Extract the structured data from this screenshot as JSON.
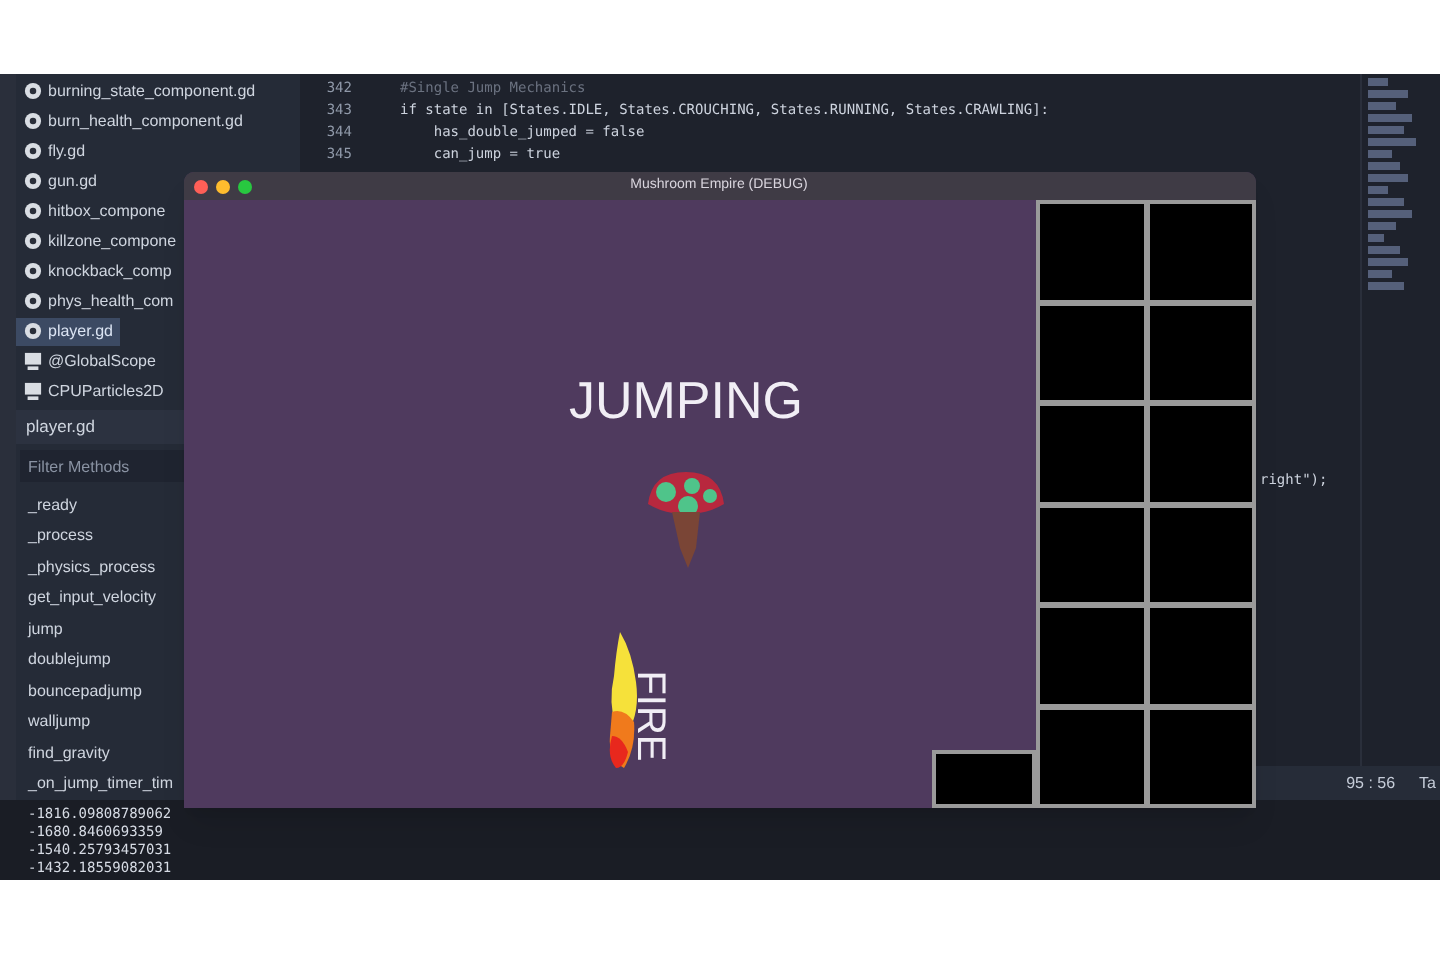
{
  "script_list": {
    "items": [
      {
        "label": "burning_state_component.gd",
        "kind": "script",
        "selected": false
      },
      {
        "label": "burn_health_component.gd",
        "kind": "script",
        "selected": false
      },
      {
        "label": "fly.gd",
        "kind": "script",
        "selected": false
      },
      {
        "label": "gun.gd",
        "kind": "script",
        "selected": false
      },
      {
        "label": "hitbox_compone",
        "kind": "script",
        "selected": false
      },
      {
        "label": "killzone_compone",
        "kind": "script",
        "selected": false
      },
      {
        "label": "knockback_comp",
        "kind": "script",
        "selected": false
      },
      {
        "label": "phys_health_com",
        "kind": "script",
        "selected": false
      },
      {
        "label": "player.gd",
        "kind": "script",
        "selected": true
      },
      {
        "label": "@GlobalScope",
        "kind": "class",
        "selected": false
      },
      {
        "label": "CPUParticles2D",
        "kind": "class",
        "selected": false
      }
    ]
  },
  "current_script": "player.gd",
  "method_filter": {
    "placeholder": "Filter Methods"
  },
  "methods": [
    "_ready",
    "_process",
    "_physics_process",
    "get_input_velocity",
    "jump",
    "doublejump",
    "bouncepadjump",
    "walljump",
    "find_gravity",
    "_on_jump_timer_tim"
  ],
  "code_lines": [
    {
      "number": "342",
      "kind": "comment",
      "text": "#Single Jump Mechanics"
    },
    {
      "number": "343",
      "kind": "code",
      "text": "if state in [States.IDLE, States.CROUCHING, States.RUNNING, States.CRAWLING]:"
    },
    {
      "number": "344",
      "kind": "code",
      "text": "    has_double_jumped = false"
    },
    {
      "number": "345",
      "kind": "code",
      "text": "    can_jump = true"
    }
  ],
  "code_fragment": "right\");",
  "status_bar": {
    "position": "95 : 56",
    "tab": "Ta"
  },
  "output_lines": [
    "-1816.09808789062",
    "-1680.8460693359",
    "-1540.25793457031",
    "-1432.18559082031"
  ],
  "game_window": {
    "title": "Mushroom Empire (DEBUG)",
    "state_label": "JUMPING",
    "vertical_label": "FIRE"
  }
}
